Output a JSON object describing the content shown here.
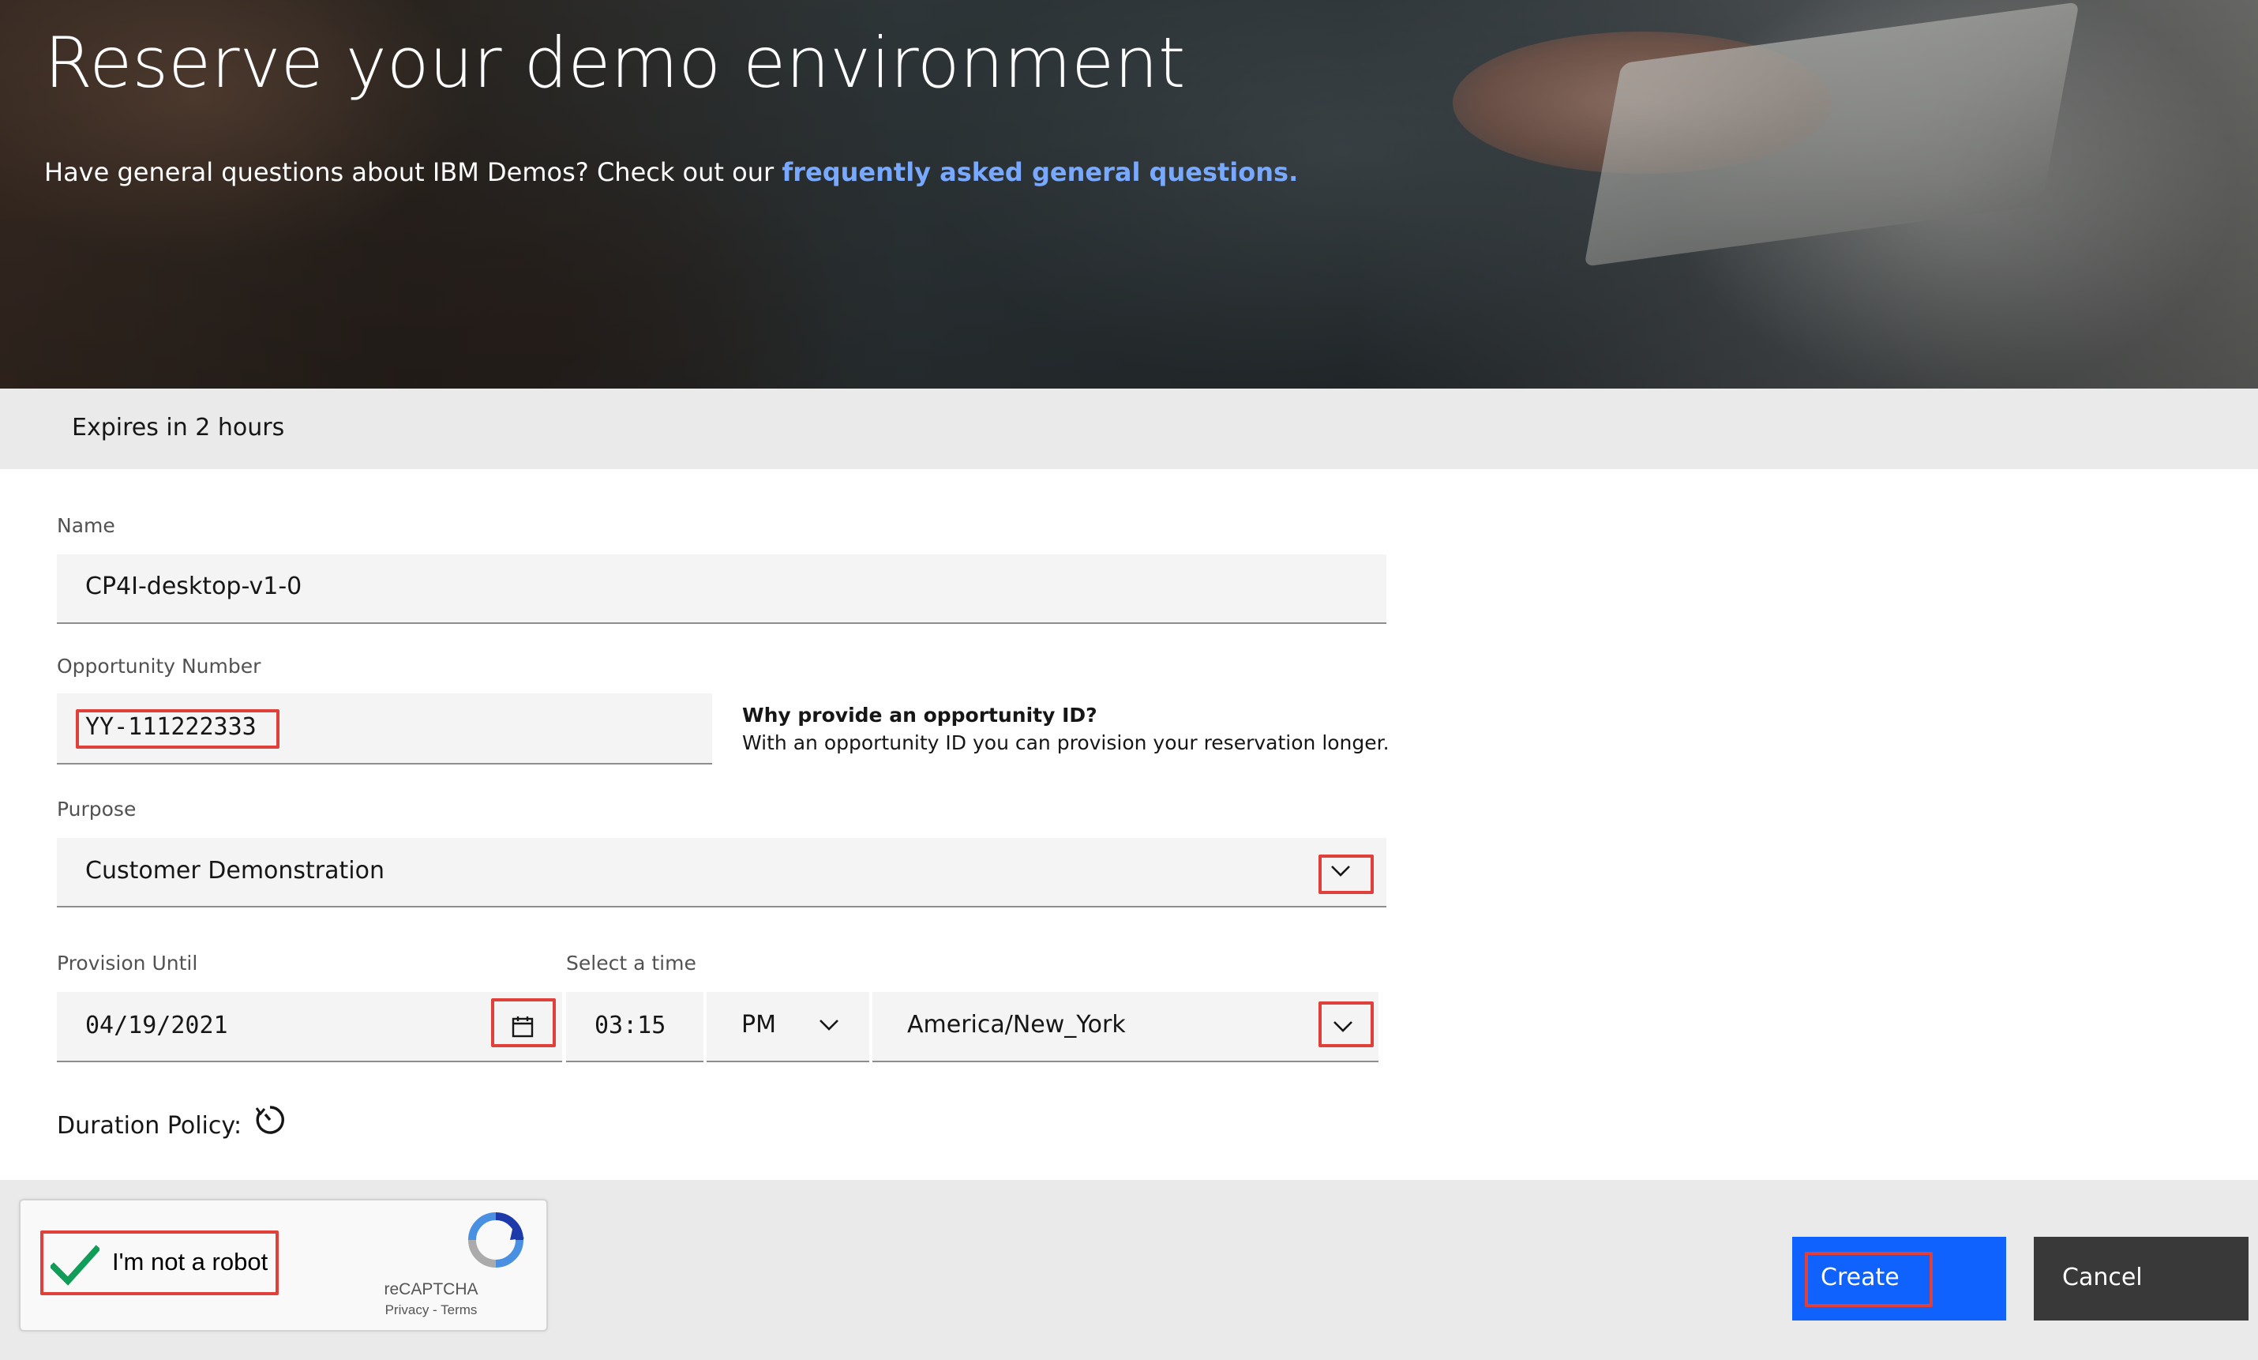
{
  "hero": {
    "title": "Reserve your demo environment",
    "subtitle_prefix": "Have general questions about IBM Demos? Check out our ",
    "subtitle_link": "frequently asked general questions."
  },
  "expiry": {
    "text": "Expires in 2 hours"
  },
  "form": {
    "name": {
      "label": "Name",
      "value": "CP4I-desktop-v1-0"
    },
    "opportunity": {
      "label": "Opportunity Number",
      "value": "YY-111222333",
      "help_title": "Why provide an opportunity ID?",
      "help_text": "With an opportunity ID you can provision your reservation longer."
    },
    "purpose": {
      "label": "Purpose",
      "value": "Customer Demonstration"
    },
    "provision": {
      "label": "Provision Until",
      "date": "04/19/2021"
    },
    "time": {
      "label": "Select a time",
      "value": "03:15",
      "ampm": "PM",
      "timezone": "America/New_York"
    },
    "duration_policy": {
      "label": "Duration Policy:"
    }
  },
  "captcha": {
    "label": "I'm not a robot",
    "brand": "reCAPTCHA",
    "links": "Privacy - Terms",
    "checked": true
  },
  "actions": {
    "create": "Create",
    "cancel": "Cancel"
  },
  "colors": {
    "primary_button": "#0f62fe",
    "secondary_button": "#393939",
    "link": "#78a9ff",
    "annotation": "#e0403a",
    "checkmark": "#0f9d58"
  },
  "icons": {
    "purpose_dropdown": "chevron-down-icon",
    "date_picker": "calendar-icon",
    "ampm_dropdown": "chevron-down-icon",
    "timezone_dropdown": "chevron-down-icon",
    "duration_policy": "timer-icon",
    "captcha_check": "checkmark-icon",
    "captcha_logo": "recaptcha-logo-icon"
  }
}
